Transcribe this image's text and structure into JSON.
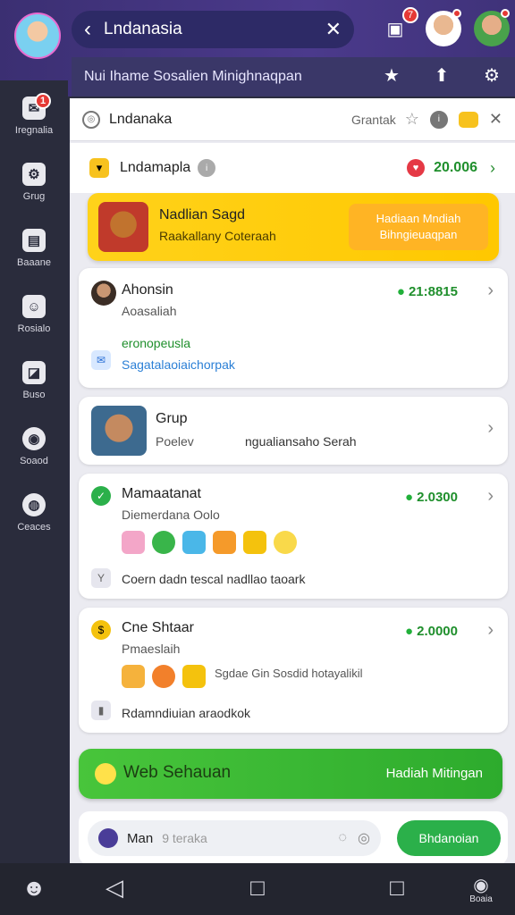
{
  "header": {
    "search_text": "Lndanasia",
    "subtitle": "Nui Ihame  Sosalien Minighnaqpan",
    "notif_count": "7"
  },
  "sidebar": {
    "items": [
      {
        "label": "Iregnalia",
        "badge": "1"
      },
      {
        "label": "Grug"
      },
      {
        "label": "Baaane"
      },
      {
        "label": "Rosialo"
      },
      {
        "label": "Buso"
      },
      {
        "label": "Soaod"
      },
      {
        "label": "Ceaces"
      }
    ]
  },
  "room": {
    "title": "Lndanaka",
    "right_label": "Grantak"
  },
  "section": {
    "title": "Lndamapla",
    "value": "20.006"
  },
  "banner": {
    "title": "Nadlian Sagd",
    "subtitle": "Raakallany  Coteraah",
    "button_line1": "Hadiaan Mndiah",
    "button_line2": "Bihngieuaqpan"
  },
  "cards": [
    {
      "name": "Ahonsin",
      "sub": "Aoasaliah",
      "amount": "21:8815",
      "line1": "eronopeusla",
      "line2": "Sagatalaoiaichorpak"
    },
    {
      "name": "Grup",
      "sub": "Poelev",
      "line1": "ngualiansaho Serah"
    },
    {
      "name": "Mamaatanat",
      "sub": "Diemerdana Oolo",
      "amount": "2.0300",
      "line1": "Coern dadn tescal  nadllao taoark"
    },
    {
      "name": "Cne Shtaar",
      "sub": "Pmaeslaih",
      "amount": "2.0000",
      "line1": "Sgdae Gin Sosdid hotayalikil",
      "line2": "Rdamndiuian araodkok"
    }
  ],
  "green_bar": {
    "label": "Web Sehauan",
    "action": "Hadiah Mitingan"
  },
  "compose": {
    "mention": "Man",
    "placeholder": "9 teraka",
    "send_label": "Bhdanoian"
  },
  "nav": {
    "right_label": "Boaia"
  }
}
